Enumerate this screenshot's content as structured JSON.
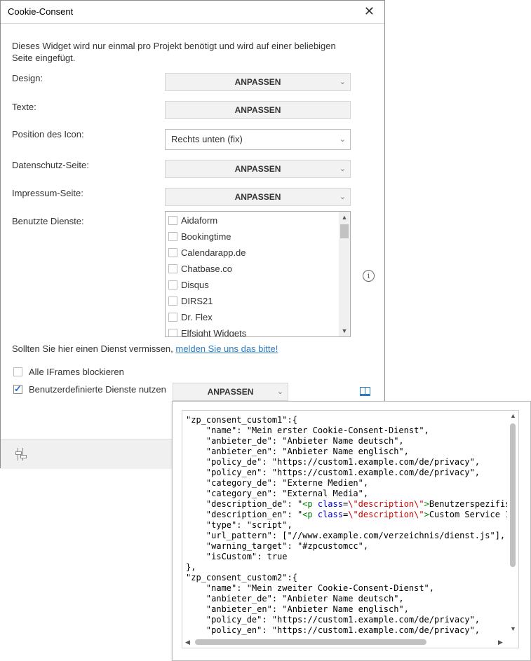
{
  "window": {
    "title": "Cookie-Consent",
    "close_label": "✕"
  },
  "intro": "Dieses Widget wird nur einmal pro Projekt benötigt und wird auf einer beliebigen Seite eingefügt.",
  "fields": {
    "design": {
      "label": "Design:",
      "button": "ANPASSEN"
    },
    "texte": {
      "label": "Texte:",
      "button": "ANPASSEN"
    },
    "position": {
      "label": "Position des Icon:",
      "value": "Rechts unten (fix)"
    },
    "datenschutz": {
      "label": "Datenschutz-Seite:",
      "button": "ANPASSEN"
    },
    "impressum": {
      "label": "Impressum-Seite:",
      "button": "ANPASSEN"
    },
    "dienste": {
      "label": "Benutzte Dienste:",
      "items": [
        "Aidaform",
        "Bookingtime",
        "Calendarapp.de",
        "Chatbase.co",
        "Disqus",
        "DIRS21",
        "Dr. Flex",
        "Elfsight Widgets"
      ]
    }
  },
  "missing": {
    "text": "Sollten Sie hier einen Dienst vermissen, ",
    "link": "melden Sie uns das bitte!"
  },
  "options": {
    "iframes": {
      "label": "Alle IFrames blockieren",
      "checked": false
    },
    "custom": {
      "label": "Benutzerdefinierte Dienste nutzen",
      "checked": true,
      "button": "ANPASSEN"
    }
  },
  "colors": {
    "link": "#2b7bc1",
    "check": "#1a6fc0",
    "code_tag": "#008000",
    "code_attr": "#0000cc",
    "code_string": "#cc0000"
  },
  "icons": {
    "info": "info-icon",
    "book": "book-icon",
    "settings": "sliders-icon"
  },
  "code": {
    "lines": [
      "\"zp_consent_custom1\":{",
      "    \"name\": \"Mein erster Cookie-Consent-Dienst\",",
      "    \"anbieter_de\": \"Anbieter Name deutsch\",",
      "    \"anbieter_en\": \"Anbieter Name englisch\",",
      "    \"policy_de\": \"https://custom1.example.com/de/privacy\",",
      "    \"policy_en\": \"https://custom1.example.com/de/privacy\",",
      "    \"category_de\": \"Externe Medien\",",
      "    \"category_en\": \"External Media\",",
      "    \"description_de\": \"<p class=\\\"description\\\">Benutzerspezifis",
      "    \"description_en\": \"<p class=\\\"description\\\">Custom Service 1",
      "    \"type\": \"script\",",
      "    \"url_pattern\": [\"//www.example.com/verzeichnis/dienst.js\"],",
      "    \"warning_target\": \"#zpcustomcc\",",
      "    \"isCustom\": true",
      "},",
      "\"zp_consent_custom2\":{",
      "    \"name\": \"Mein zweiter Cookie-Consent-Dienst\",",
      "    \"anbieter_de\": \"Anbieter Name deutsch\",",
      "    \"anbieter_en\": \"Anbieter Name englisch\",",
      "    \"policy_de\": \"https://custom1.example.com/de/privacy\",",
      "    \"policy_en\": \"https://custom1.example.com/de/privacy\","
    ]
  }
}
